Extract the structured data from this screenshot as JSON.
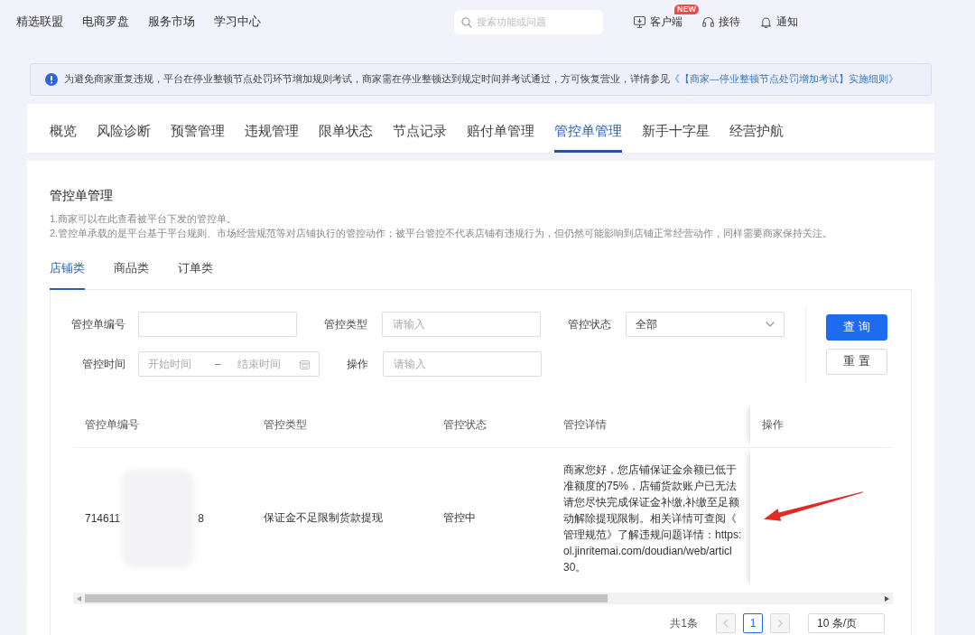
{
  "top_nav": {
    "links": [
      {
        "label": "精选联盟"
      },
      {
        "label": "电商罗盘"
      },
      {
        "label": "服务市场"
      },
      {
        "label": "学习中心"
      }
    ],
    "search": {
      "placeholder": "搜索功能或问题"
    },
    "actions": [
      {
        "label": "客户端",
        "badge": "NEW"
      },
      {
        "label": "接待"
      },
      {
        "label": "通知"
      }
    ]
  },
  "notice": {
    "text": "为避免商家重复违规，平台在停业整顿节点处罚环节增加规则考试，商家需在停业整顿达到规定时间并考试通过，方可恢复营业，详情参见",
    "link": "《【商家—停业整顿节点处罚增加考试】实施细则》"
  },
  "tabs": [
    {
      "label": "概览",
      "selected": false
    },
    {
      "label": "风险诊断",
      "selected": false
    },
    {
      "label": "预警管理",
      "selected": false
    },
    {
      "label": "违规管理",
      "selected": false
    },
    {
      "label": "限单状态",
      "selected": false
    },
    {
      "label": "节点记录",
      "selected": false
    },
    {
      "label": "赔付单管理",
      "selected": false
    },
    {
      "label": "管控单管理",
      "selected": true
    },
    {
      "label": "新手十字星",
      "selected": false
    },
    {
      "label": "经营护航",
      "selected": false
    }
  ],
  "section": {
    "title": "管控单管理",
    "notes": [
      "1.商家可以在此查看被平台下发的管控单。",
      "2.管控单承载的是平台基于平台规则、市场经营规范等对店铺执行的管控动作；被平台管控不代表店铺有违规行为，但仍然可能影响到店铺正常经营动作，同样需要商家保持关注。"
    ]
  },
  "sub_tabs": [
    {
      "label": "店铺类",
      "selected": true
    },
    {
      "label": "商品类",
      "selected": false
    },
    {
      "label": "订单类",
      "selected": false
    }
  ],
  "filters": [
    {
      "kind": "input",
      "label": "管控单编号"
    },
    {
      "kind": "input",
      "label": "管控类型",
      "placeholder": "请输入"
    },
    {
      "kind": "select",
      "label": "管控状态",
      "value": "全部"
    },
    {
      "kind": "date_range",
      "label": "管控时间",
      "start_placeholder": "开始时间",
      "separator": "–",
      "end_placeholder": "结束时间"
    },
    {
      "kind": "input",
      "label": "操作",
      "placeholder": "请输入"
    }
  ],
  "buttons": [
    {
      "label": "查 询",
      "kind": "primary"
    },
    {
      "label": "重 置",
      "kind": "default"
    }
  ],
  "table": {
    "columns": [
      "管控单编号",
      "管控类型",
      "管控状态",
      "管控详情",
      "操作"
    ],
    "rows": [
      {
        "order_number_start": "714611",
        "order_number_end": "8",
        "type": "保证金不足限制货款提现",
        "status": "管控中",
        "detail_lines": [
          "商家您好，您店铺保证金余额已低于",
          "准额度的75%，店铺货款账户已无法",
          "请您尽快完成保证金补缴,补缴至足额",
          "动解除提现限制。相关详情可查阅《",
          "管理规范》了解违规问题详情：https:",
          "ol.jinritemai.com/doudian/web/articl",
          "30。"
        ]
      }
    ]
  },
  "pagination": {
    "total": "共1条",
    "prev": {
      "disabled": true
    },
    "pages": [
      {
        "label": "1",
        "selected": true
      }
    ],
    "next": {
      "disabled": true
    },
    "page_size": "10 条/页"
  }
}
